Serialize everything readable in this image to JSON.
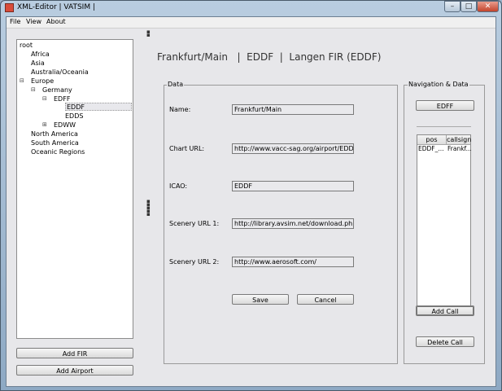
{
  "window": {
    "title": "XML-Editor | VATSIM |",
    "controls": {
      "minimize": "–",
      "maximize": "□",
      "close": "✕"
    }
  },
  "menu": {
    "items": [
      "File",
      "View",
      "About"
    ]
  },
  "tree": {
    "root": "root",
    "nodes": [
      "Africa",
      "Asia",
      "Australia/Oceania",
      "Europe",
      "Germany",
      "EDFF",
      "EDDF",
      "EDDS",
      "EDWW",
      "North America",
      "South America",
      "Oceanic Regions"
    ],
    "toggles": {
      "europe": "⊟",
      "germany": "⊟",
      "edff": "⊟",
      "edww": "⊞"
    },
    "selected": "EDDF"
  },
  "left_buttons": {
    "add_fir": "Add FIR",
    "add_airport": "Add Airport"
  },
  "header": {
    "title": "Frankfurt/Main   |  EDDF  |  Langen FIR (EDDF)"
  },
  "data_group": {
    "label": "Data",
    "fields": [
      {
        "label": "Name:",
        "value": "Frankfurt/Main"
      },
      {
        "label": "Chart URL:",
        "value": "http://www.vacc-sag.org/airport/EDDF"
      },
      {
        "label": "ICAO:",
        "value": "EDDF"
      },
      {
        "label": "Scenery URL 1:",
        "value": "http://library.avsim.net/download.php?l"
      },
      {
        "label": "Scenery URL 2:",
        "value": "http://www.aerosoft.com/"
      }
    ],
    "save": "Save",
    "cancel": "Cancel"
  },
  "nav_group": {
    "label": "Navigation & Data",
    "edff_button": "EDFF",
    "table": {
      "columns": [
        "pos",
        "callsign"
      ],
      "rows": [
        [
          "EDDF_...",
          "Frankf..."
        ]
      ]
    },
    "add_call": "Add Call",
    "delete_call": "Delete Call"
  }
}
